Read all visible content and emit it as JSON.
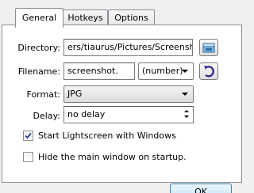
{
  "tabs": [
    "General",
    "Hotkeys",
    "Options"
  ],
  "directory": {
    "label": "Directory:",
    "value": "ers/tiaurus/Pictures/Screenshots"
  },
  "filename": {
    "label": "Filename:",
    "value": "screenshot.",
    "numbering": "(number)"
  },
  "format": {
    "label": "Format:",
    "value": "JPG"
  },
  "delay": {
    "label": "Delay:",
    "value": "no delay"
  },
  "checkboxes": {
    "start_with_windows": {
      "label": "Start Lightscreen with Windows",
      "checked": true
    },
    "hide_main_window": {
      "label": "Hide the main window on startup.",
      "checked": false
    }
  },
  "buttons": {
    "ok": "OK"
  },
  "icons": {
    "browse": "folder-icon",
    "reset": "refresh-icon"
  }
}
